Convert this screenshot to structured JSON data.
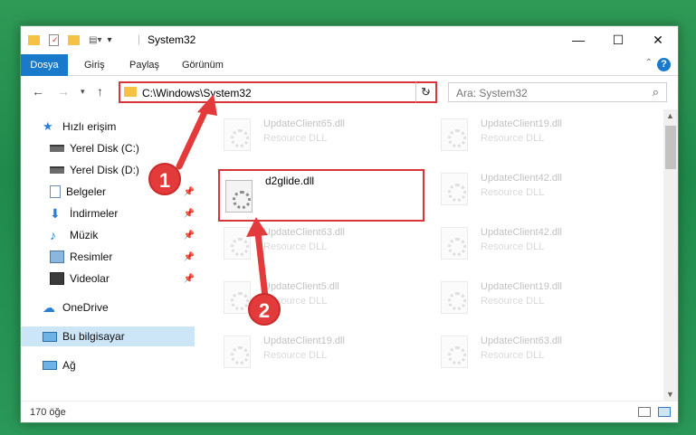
{
  "window": {
    "title": "System32"
  },
  "ribbon": {
    "tabs": [
      {
        "label": "Dosya",
        "active": true
      },
      {
        "label": "Giriş"
      },
      {
        "label": "Paylaş"
      },
      {
        "label": "Görünüm"
      }
    ]
  },
  "address": {
    "path": "C:\\Windows\\System32",
    "search_placeholder": "Ara: System32"
  },
  "sidebar": {
    "items": [
      {
        "label": "Hızlı erişim",
        "icon": "star-icon"
      },
      {
        "label": "Yerel Disk (C:)",
        "icon": "drive-icon"
      },
      {
        "label": "Yerel Disk (D:)",
        "icon": "drive-icon"
      },
      {
        "label": "Belgeler",
        "icon": "documents-icon"
      },
      {
        "label": "İndirmeler",
        "icon": "download-icon"
      },
      {
        "label": "Müzik",
        "icon": "music-icon"
      },
      {
        "label": "Resimler",
        "icon": "pictures-icon"
      },
      {
        "label": "Videolar",
        "icon": "videos-icon"
      },
      {
        "label": "OneDrive",
        "icon": "cloud-icon"
      },
      {
        "label": "Bu bilgisayar",
        "icon": "computer-icon"
      },
      {
        "label": "Ağ",
        "icon": "network-icon"
      }
    ]
  },
  "files": {
    "left": [
      {
        "name": "UpdateClient65.dll",
        "type": "Resource DLL"
      },
      {
        "name": "d2glide.dll",
        "type": ""
      },
      {
        "name": "UpdateClient63.dll",
        "type": "Resource DLL"
      },
      {
        "name": "UpdateClient5.dll",
        "type": "Resource DLL"
      },
      {
        "name": "UpdateClient19.dll",
        "type": "Resource DLL"
      }
    ],
    "right": [
      {
        "name": "UpdateClient19.dll",
        "type": "Resource DLL"
      },
      {
        "name": "UpdateClient42.dll",
        "type": "Resource DLL"
      },
      {
        "name": "UpdateClient42.dll",
        "type": "Resource DLL"
      },
      {
        "name": "UpdateClient19.dll",
        "type": "Resource DLL"
      },
      {
        "name": "UpdateClient63.dll",
        "type": "Resource DLL"
      }
    ]
  },
  "status": {
    "count": "170 öğe"
  },
  "annotations": {
    "step1": "1",
    "step2": "2",
    "color": "#e33b3b"
  }
}
